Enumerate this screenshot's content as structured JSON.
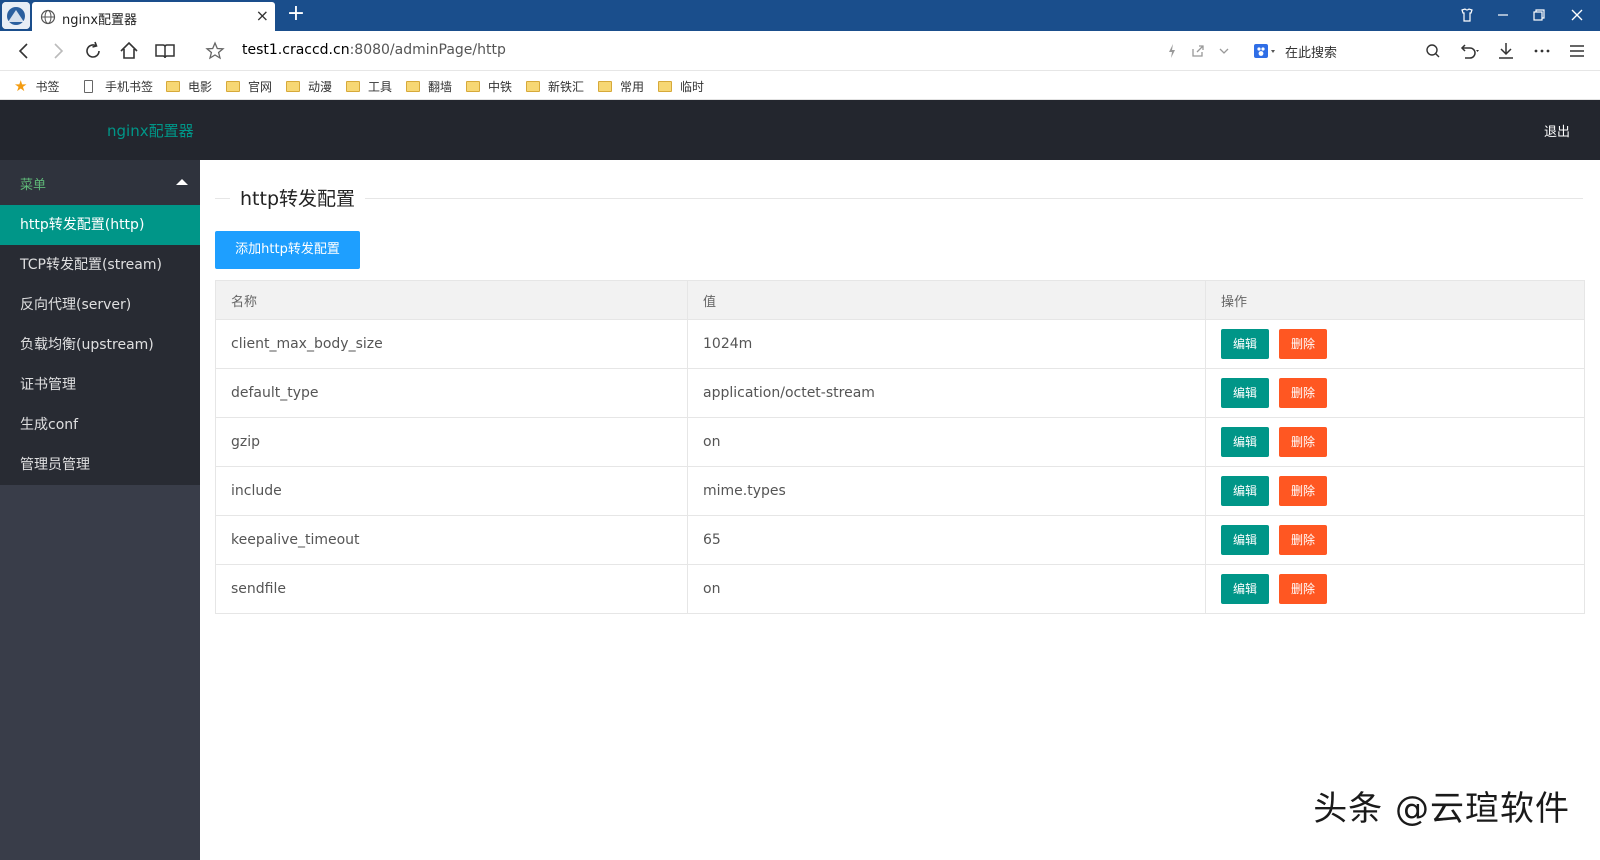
{
  "browser": {
    "tab_title": "nginx配置器",
    "tab_close": "×",
    "new_tab": "+",
    "url_host": "test1.craccd.cn",
    "url_rest": ":8080/adminPage/http",
    "search_placeholder": "在此搜索",
    "bookmarks": [
      {
        "label": "书签",
        "icon": "star-icon"
      },
      {
        "label": "手机书签",
        "icon": "phone-icon"
      },
      {
        "label": "电影",
        "icon": "folder-icon"
      },
      {
        "label": "官网",
        "icon": "folder-icon"
      },
      {
        "label": "动漫",
        "icon": "folder-icon"
      },
      {
        "label": "工具",
        "icon": "folder-icon"
      },
      {
        "label": "翻墙",
        "icon": "folder-icon"
      },
      {
        "label": "中铁",
        "icon": "folder-icon"
      },
      {
        "label": "新铁汇",
        "icon": "folder-icon"
      },
      {
        "label": "常用",
        "icon": "folder-icon"
      },
      {
        "label": "临时",
        "icon": "folder-icon"
      }
    ]
  },
  "header": {
    "brand": "nginx配置器",
    "logout": "退出"
  },
  "sidebar": {
    "menu_title": "菜单",
    "items": [
      {
        "label": "http转发配置(http)",
        "active": true
      },
      {
        "label": "TCP转发配置(stream)",
        "active": false
      },
      {
        "label": "反向代理(server)",
        "active": false
      },
      {
        "label": "负载均衡(upstream)",
        "active": false
      },
      {
        "label": "证书管理",
        "active": false
      },
      {
        "label": "生成conf",
        "active": false
      },
      {
        "label": "管理员管理",
        "active": false
      }
    ]
  },
  "main": {
    "section_title": "http转发配置",
    "add_button": "添加http转发配置",
    "table": {
      "headers": [
        "名称",
        "值",
        "操作"
      ],
      "edit_label": "编辑",
      "delete_label": "删除",
      "rows": [
        {
          "name": "client_max_body_size",
          "value": "1024m"
        },
        {
          "name": "default_type",
          "value": "application/octet-stream"
        },
        {
          "name": "gzip",
          "value": "on"
        },
        {
          "name": "include",
          "value": "mime.types"
        },
        {
          "name": "keepalive_timeout",
          "value": "65"
        },
        {
          "name": "sendfile",
          "value": "on"
        }
      ]
    }
  },
  "watermark": "头条 @云瑄软件",
  "colors": {
    "header_bg": "#23262e",
    "sidebar_bg": "#393d49",
    "accent_green": "#009688",
    "primary_blue": "#1e9fff",
    "danger_orange": "#ff5722",
    "tabstrip_blue": "#1a4e8c"
  }
}
